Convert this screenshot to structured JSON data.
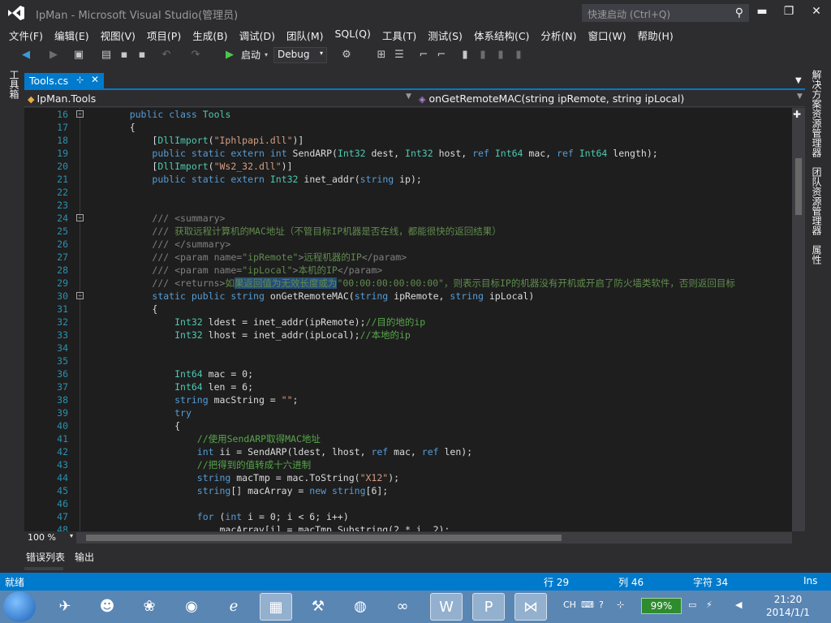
{
  "window": {
    "title": "IpMan - Microsoft Visual Studio(管理员)",
    "quick_launch_placeholder": "快速启动 (Ctrl+Q)",
    "minimize": "▬",
    "restore": "❐",
    "close": "✕"
  },
  "menu": [
    "文件(F)",
    "编辑(E)",
    "视图(V)",
    "项目(P)",
    "生成(B)",
    "调试(D)",
    "团队(M)",
    "SQL(Q)",
    "工具(T)",
    "测试(S)",
    "体系结构(C)",
    "分析(N)",
    "窗口(W)",
    "帮助(H)"
  ],
  "toolbar": {
    "start_label": "启动",
    "config_value": "Debug"
  },
  "side_tabs": {
    "left": "工具箱",
    "right": [
      "解决方案资源管理器",
      "团队资源管理器",
      "属性"
    ]
  },
  "document_tab": {
    "label": "Tools.cs",
    "pin": "⊹",
    "close": "✕"
  },
  "navigation": {
    "type_name": "IpMan.Tools",
    "member_name": "onGetRemoteMAC(string ipRemote, string ipLocal)"
  },
  "code_lines": [
    {
      "n": "16",
      "fold": "⊟",
      "text": "    public class Tools"
    },
    {
      "n": "17",
      "fold": "",
      "text": "    {"
    },
    {
      "n": "18",
      "fold": "",
      "text": "        [DllImport(\"Iphlpapi.dll\")]"
    },
    {
      "n": "19",
      "fold": "",
      "text": "        public static extern int SendARP(Int32 dest, Int32 host, ref Int64 mac, ref Int64 length);"
    },
    {
      "n": "20",
      "fold": "",
      "text": "        [DllImport(\"Ws2_32.dll\")]"
    },
    {
      "n": "21",
      "fold": "",
      "text": "        public static extern Int32 inet_addr(string ip);"
    },
    {
      "n": "22",
      "fold": "",
      "text": ""
    },
    {
      "n": "23",
      "fold": "",
      "text": ""
    },
    {
      "n": "24",
      "fold": "⊟",
      "text": "        /// <summary>"
    },
    {
      "n": "25",
      "fold": "",
      "text": "        /// 获取远程计算机的MAC地址（不管目标IP机器是否在线，都能很快的返回结果）"
    },
    {
      "n": "26",
      "fold": "",
      "text": "        /// </summary>"
    },
    {
      "n": "27",
      "fold": "",
      "text": "        /// <param name=\"ipRemote\">远程机器的IP</param>"
    },
    {
      "n": "28",
      "fold": "",
      "text": "        /// <param name=\"ipLocal\">本机的IP</param>"
    },
    {
      "n": "29",
      "fold": "",
      "text": "        /// <returns>如果返回值为无效长度或为\"00:00:00:00:00:00\"，则表示目标IP的机器没有开机或开启了防火墙类软件，否则返回目标"
    },
    {
      "n": "30",
      "fold": "⊟",
      "text": "        static public string onGetRemoteMAC(string ipRemote, string ipLocal)"
    },
    {
      "n": "31",
      "fold": "",
      "text": "        {"
    },
    {
      "n": "32",
      "fold": "",
      "text": "            Int32 ldest = inet_addr(ipRemote);//目的地的ip"
    },
    {
      "n": "33",
      "fold": "",
      "text": "            Int32 lhost = inet_addr(ipLocal);//本地的ip"
    },
    {
      "n": "34",
      "fold": "",
      "text": ""
    },
    {
      "n": "35",
      "fold": "",
      "text": ""
    },
    {
      "n": "36",
      "fold": "",
      "text": "            Int64 mac = 0;"
    },
    {
      "n": "37",
      "fold": "",
      "text": "            Int64 len = 6;"
    },
    {
      "n": "38",
      "fold": "",
      "text": "            string macString = \"\";"
    },
    {
      "n": "39",
      "fold": "",
      "text": "            try"
    },
    {
      "n": "40",
      "fold": "",
      "text": "            {"
    },
    {
      "n": "41",
      "fold": "",
      "text": "                //使用SendARP取得MAC地址"
    },
    {
      "n": "42",
      "fold": "",
      "text": "                int ii = SendARP(ldest, lhost, ref mac, ref len);"
    },
    {
      "n": "43",
      "fold": "",
      "text": "                //把得到的值转成十六进制"
    },
    {
      "n": "44",
      "fold": "",
      "text": "                string macTmp = mac.ToString(\"X12\");"
    },
    {
      "n": "45",
      "fold": "",
      "text": "                string[] macArray = new string[6];"
    },
    {
      "n": "46",
      "fold": "",
      "text": ""
    },
    {
      "n": "47",
      "fold": "",
      "text": "                for (int i = 0; i < 6; i++)"
    },
    {
      "n": "48",
      "fold": "",
      "text": "                    macArray[i] = macTmp.Substring(2 * i, 2);"
    }
  ],
  "editor": {
    "zoom": "100 %"
  },
  "bottom_tabs": [
    "错误列表",
    "输出"
  ],
  "status": {
    "state": "就绪",
    "line": "行 29",
    "col": "列 46",
    "char": "字符 34",
    "mode": "Ins"
  },
  "taskbar": {
    "battery": "99%",
    "ime": "CH",
    "time": "21:20",
    "date": "2014/1/1"
  },
  "colors": {
    "accent": "#007acc",
    "editor_bg": "#1e1e1e",
    "chrome_bg": "#2d2d30",
    "keyword": "#569cd6",
    "type": "#4ec9b0",
    "string": "#d69d85",
    "comment": "#57a64a"
  }
}
